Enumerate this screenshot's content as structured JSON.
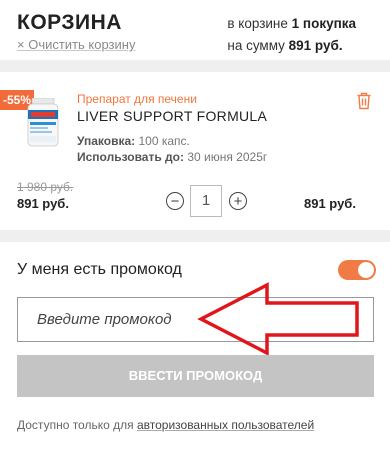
{
  "header": {
    "title": "КОРЗИНА",
    "clear_label": "× Очистить корзину",
    "summary_prefix": "в корзине ",
    "summary_count": "1 покупка",
    "summary_sum_prefix": "на сумму ",
    "summary_sum": "891 руб."
  },
  "item": {
    "discount": "-55%",
    "category": "Препарат для печени",
    "name": "LIVER SUPPORT FORMULA",
    "pack_label": "Упаковка:",
    "pack_value": " 100 капс.",
    "use_by_label": "Использовать до:",
    "use_by_value": " 30 июня 2025г",
    "old_price": "1 980 руб.",
    "price": "891 руб.",
    "quantity": "1",
    "minus": "−",
    "plus": "+",
    "total": "891 руб."
  },
  "promo": {
    "title": "У меня есть промокод",
    "toggle_on": true,
    "placeholder": "Введите промокод",
    "button_label": "ВВЕСТИ ПРОМОКОД",
    "note_text": "Доступно только для ",
    "note_link": "авторизованных пользователей"
  },
  "colors": {
    "accent": "#f07b45",
    "annotation_arrow": "#e0161c",
    "button_disabled": "#c4c4c4"
  }
}
